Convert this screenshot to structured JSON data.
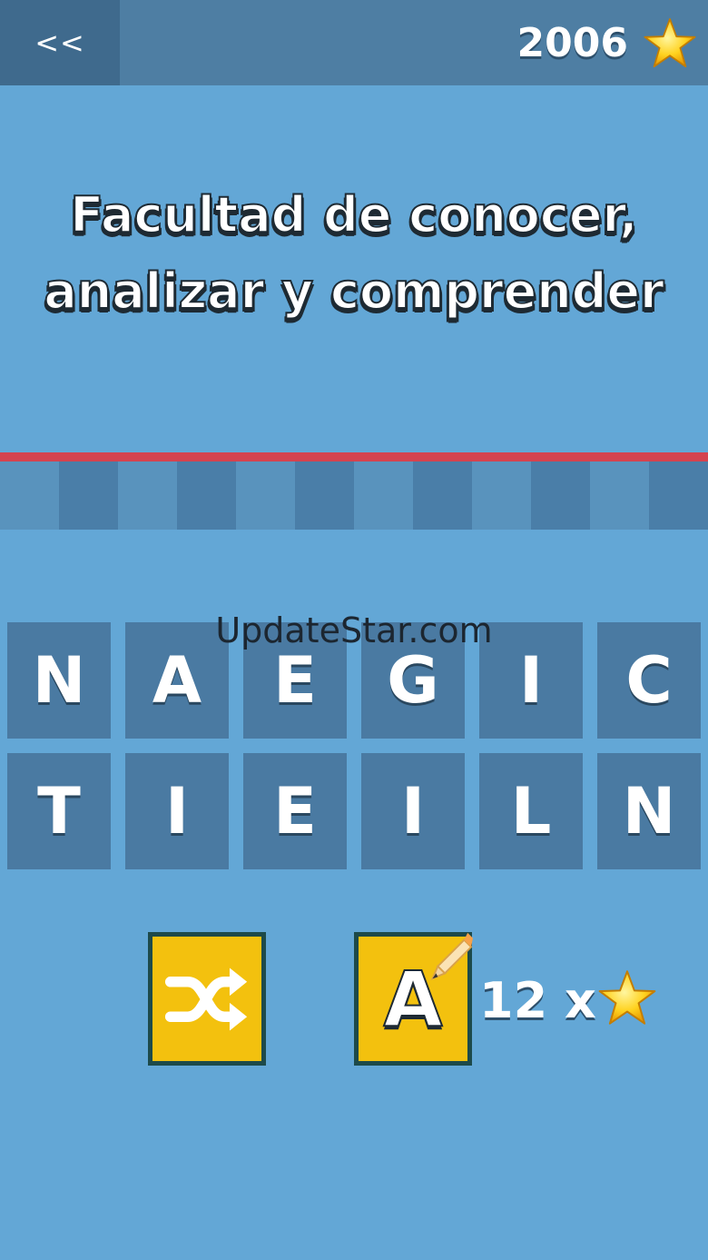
{
  "header": {
    "back_label": "<<",
    "score": "2006"
  },
  "clue": {
    "line1": "Facultad de conocer,",
    "line2": "analizar y comprender"
  },
  "answer_slots": 12,
  "letters": {
    "row1": [
      "N",
      "A",
      "E",
      "G",
      "I",
      "C"
    ],
    "row2": [
      "T",
      "I",
      "E",
      "I",
      "L",
      "N"
    ]
  },
  "watermark": "UpdateStar.com",
  "actions": {
    "hint_letter": "A",
    "hint_cost": "12 x"
  },
  "colors": {
    "background": "#63a7d6",
    "topbar": "#4e7ea3",
    "tile": "#4a7aa2",
    "accent_red": "#d4434f",
    "button_yellow": "#f3c10e"
  },
  "icons": {
    "score": "star-icon",
    "shuffle": "shuffle-icon",
    "hint": "pencil-icon",
    "cost": "star-icon"
  }
}
